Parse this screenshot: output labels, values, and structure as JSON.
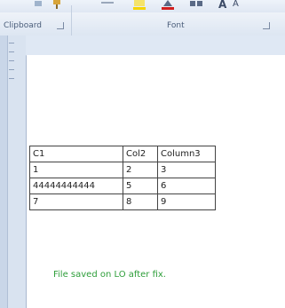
{
  "ribbon": {
    "groups": [
      {
        "label": "Clipboard"
      },
      {
        "label": "Font"
      }
    ],
    "font_glyphs": [
      "A",
      "A"
    ]
  },
  "table": {
    "rows": [
      [
        "C1",
        "Col2",
        "Column3"
      ],
      [
        "1",
        "2",
        "3"
      ],
      [
        "44444444444",
        "5",
        "6"
      ],
      [
        "7",
        "8",
        "9"
      ]
    ]
  },
  "document": {
    "status_text": "File saved on LO after fix."
  },
  "colors": {
    "status_text": "#2e9e3a",
    "ribbon_bg": "#dde6f2",
    "highlight_yellow": "#f5d400",
    "font_red": "#d21f1f"
  }
}
